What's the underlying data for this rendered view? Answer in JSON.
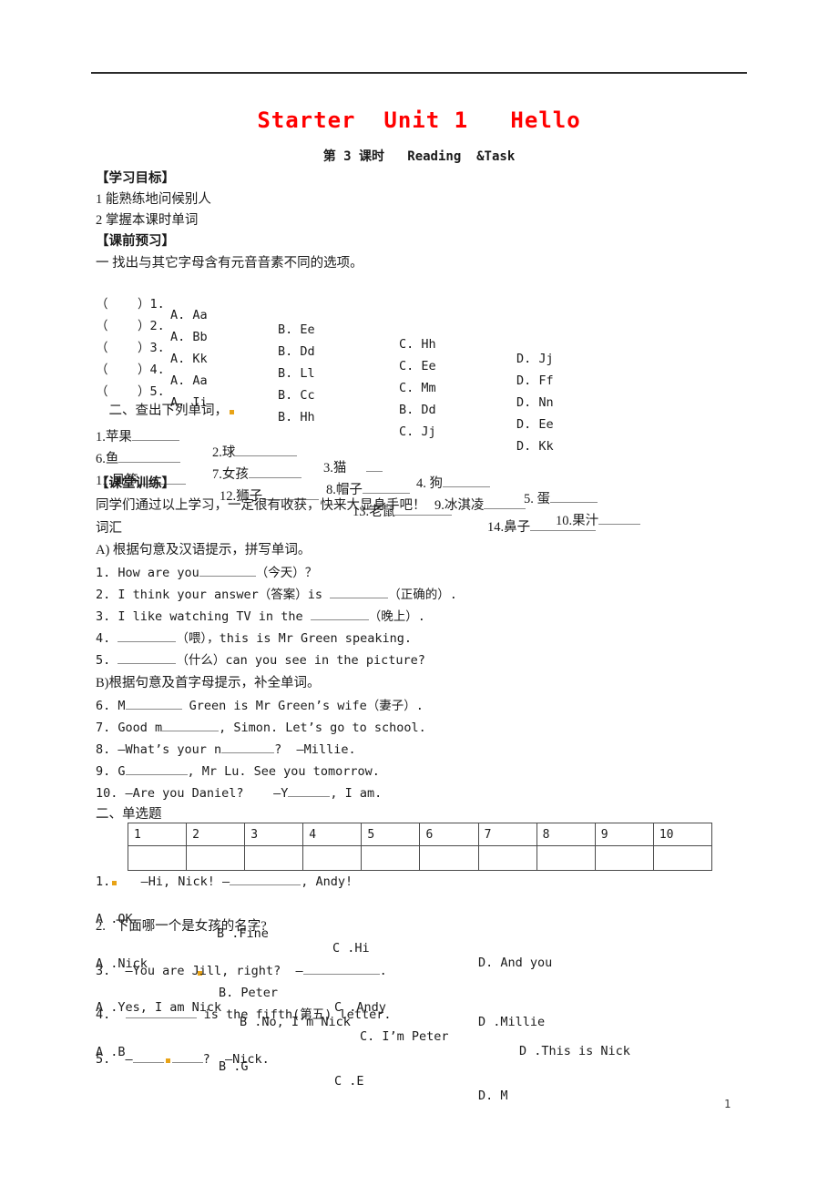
{
  "document": {
    "title": "Starter  Unit 1   Hello",
    "subtitle": "第 3 课时   Reading  &Task",
    "page_number": "1",
    "title_color": "#ff0000",
    "marker_color": "#e8a317"
  },
  "objectives": {
    "heading": "【学习目标】",
    "items": [
      "1 能熟练地问候别人",
      "2 掌握本课时单词"
    ]
  },
  "preview": {
    "heading": "【课前预习】",
    "instruction_one": "一 找出与其它字母含有元音音素不同的选项。",
    "letter_questions": [
      {
        "stem": "（    ）1.",
        "a": "A. Aa",
        "b": "B. Ee",
        "c": "C. Hh",
        "d": "D. Jj"
      },
      {
        "stem": "（    ）2.",
        "a": "A. Bb",
        "b": "B. Dd",
        "c": "C. Ee",
        "d": "D. Ff"
      },
      {
        "stem": "（    ）3.",
        "a": "A. Kk",
        "b": "B. Ll",
        "c": "C. Mm",
        "d": "D. Nn"
      },
      {
        "stem": "（    ）4.",
        "a": "A. Aa",
        "b": "B. Cc",
        "c": "B. Dd",
        "d": "D. Ee"
      },
      {
        "stem": "（    ）5.",
        "a": "A. Ii",
        "b": "B. Hh",
        "c": "C. Jj",
        "d": "D. Kk"
      }
    ],
    "instruction_two": "二、查出下列单词，",
    "vocab_rows": [
      [
        {
          "label": "1.苹果",
          "blank_width": 52
        },
        {
          "label": "2.球",
          "blank_width": 68
        },
        {
          "label": "3.猫",
          "blank_width": 18
        },
        {
          "label": "4. 狗",
          "blank_width": 52
        },
        {
          "label": "5. 蛋",
          "blank_width": 52
        }
      ],
      [
        {
          "label": "6.鱼",
          "blank_width": 68
        },
        {
          "label": "7.女孩",
          "blank_width": 58
        },
        {
          "label": "8.帽子",
          "blank_width": 52
        },
        {
          "label": "9.冰淇凌",
          "blank_width": 46
        },
        {
          "label": "10.果汁",
          "blank_width": 46
        }
      ],
      [
        {
          "label": "11.风筝",
          "blank_width": 52
        },
        {
          "label": "12.狮子",
          "blank_width": 62
        },
        {
          "label": "13.老鼠",
          "blank_width": 62
        },
        {
          "label": "14.鼻子",
          "blank_width": 72
        }
      ]
    ]
  },
  "practice": {
    "heading": "【课堂训练】",
    "intro": "同学们通过以上学习，一定很有收获，快来大显身手吧！",
    "vocab_label": "词汇",
    "part_a_instruction": "A) 根据句意及汉语提示，拼写单词。",
    "part_a_questions": [
      {
        "pre": "1. How are you",
        "blank": 62,
        "post": "（今天）？"
      },
      {
        "pre": "2. I think your answer（答案）is ",
        "blank": 64,
        "post": "（正确的）."
      },
      {
        "pre": "3. I like watching TV in the ",
        "blank": 64,
        "post": "（晚上）."
      },
      {
        "pre": "4. ",
        "blank": 64,
        "post": "（喂），this is Mr Green speaking."
      },
      {
        "pre": "5. ",
        "blank": 64,
        "post": "（什么）can you see in the picture?"
      }
    ],
    "part_b_instruction": "B)根据句意及首字母提示，补全单词。",
    "part_b_questions": [
      {
        "pre": "6. M",
        "blank": 62,
        "post": " Green is Mr Green’s wife（妻子）."
      },
      {
        "pre": "7. Good m",
        "blank": 62,
        "post": ", Simon. Let’s go to school."
      },
      {
        "pre": "8. —What’s your n",
        "blank": 58,
        "post": "?  —Millie."
      },
      {
        "pre": "9. G",
        "blank": 68,
        "post": ", Mr Lu. See you tomorrow."
      },
      {
        "pre": "10. —Are you Daniel?    —Y",
        "blank": 46,
        "post": ", I am."
      }
    ]
  },
  "multiple_choice": {
    "heading": "二、单选题",
    "answer_table": {
      "numbers": [
        "1",
        "2",
        "3",
        "4",
        "5",
        "6",
        "7",
        "8",
        "9",
        "10"
      ],
      "answers": [
        "",
        "",
        "",
        "",
        "",
        "",
        "",
        "",
        "",
        ""
      ]
    },
    "questions": [
      {
        "stem_pre": "1.",
        "has_marker": true,
        "stem_mid": "   —Hi, Nick! —",
        "blank": 78,
        "stem_post": ", Andy!",
        "options": [
          "A .OK",
          "B .Fine",
          "C .Hi",
          "D. And you"
        ],
        "option_x": [
          0,
          133,
          260,
          420
        ]
      },
      {
        "stem_pre": "2.   下面哪一个是女孩的名字?",
        "has_marker": false,
        "stem_mid": "",
        "blank": 0,
        "stem_post": "",
        "options": [
          "A .Nick",
          "B. Peter",
          "C .Andy",
          "D .Millie"
        ],
        "option_x": [
          0,
          135,
          262,
          420
        ],
        "marker_after_first_option": true
      },
      {
        "stem_pre": "3.  —You are Jill, right?  —",
        "has_marker": false,
        "stem_mid": "",
        "blank": 84,
        "stem_post": ".",
        "options": [
          "A .Yes, I am Nick",
          "B .No, I’m Nick",
          "C. I’m Peter",
          "D .This is Nick"
        ],
        "option_x": [
          0,
          158,
          290,
          465
        ]
      },
      {
        "stem_pre": "4.  ",
        "has_marker": false,
        "stem_mid": "",
        "blank": 78,
        "stem_post": " is the fifth(第五) letter.",
        "options": [
          "A .B",
          "B .G",
          "C .E",
          "D. M"
        ],
        "option_x": [
          0,
          135,
          262,
          420
        ]
      },
      {
        "stem_pre": "5.  —",
        "has_marker": false,
        "stem_mid": "",
        "blank": 72,
        "stem_post": "?  —Nick.",
        "options": [],
        "option_x": [],
        "marker_in_blank": true
      }
    ]
  }
}
